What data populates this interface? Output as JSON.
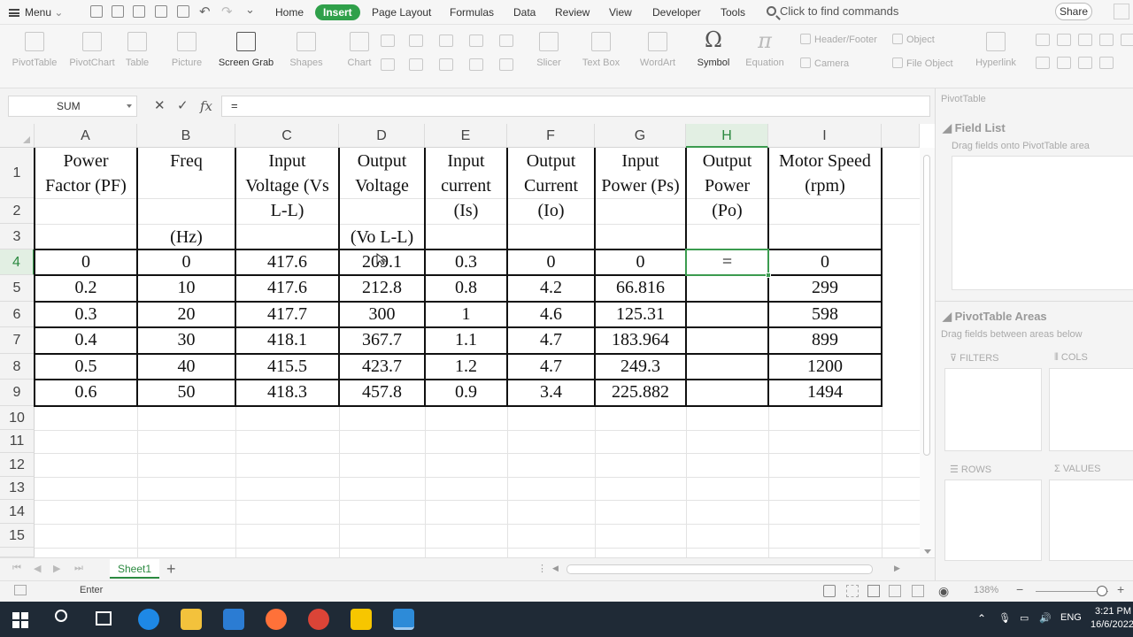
{
  "menubar": {
    "menu_label": "Menu",
    "tabs": [
      "Home",
      "Insert",
      "Page Layout",
      "Formulas",
      "Data",
      "Review",
      "View",
      "Developer",
      "Tools"
    ],
    "active_tab": "Insert",
    "find_placeholder": "Click to find commands",
    "share_label": "Share"
  },
  "ribbon": {
    "pivottable": "PivotTable",
    "pivotchart": "PivotChart",
    "table": "Table",
    "picture": "Picture",
    "screen_grab": "Screen Grab",
    "shapes": "Shapes",
    "chart": "Chart",
    "slicer": "Slicer",
    "text_box": "Text Box",
    "wordart": "WordArt",
    "symbol": "Symbol",
    "equation": "Equation",
    "header_footer": "Header/Footer",
    "object": "Object",
    "camera": "Camera",
    "file_object": "File Object",
    "hyperlink": "Hyperlink"
  },
  "formula_bar": {
    "name_box": "SUM",
    "cancel_glyph": "✕",
    "enter_glyph": "✓",
    "fx_glyph": "fx",
    "formula": "="
  },
  "sheet": {
    "columns": [
      "A",
      "B",
      "C",
      "D",
      "E",
      "F",
      "G",
      "H",
      "I"
    ],
    "selected_column": "H",
    "rows": [
      "1",
      "2",
      "3",
      "4",
      "5",
      "6",
      "7",
      "8",
      "9",
      "10",
      "11",
      "12",
      "13",
      "14",
      "15"
    ],
    "selected_row": "4",
    "headers": {
      "a": [
        "Power",
        "Factor (PF)"
      ],
      "b": [
        "Freq",
        "(Hz)"
      ],
      "c": [
        "Input",
        "Voltage (Vs",
        "L-L)"
      ],
      "d": [
        "Output",
        "Voltage",
        "(Vo L-L)"
      ],
      "e": [
        "Input",
        "current",
        "(Is)"
      ],
      "f": [
        "Output",
        "Current",
        "(Io)"
      ],
      "g": [
        "Input",
        "Power (Ps)"
      ],
      "h": [
        "Output",
        "Power",
        "(Po)"
      ],
      "i": [
        "Motor Speed",
        "(rpm)"
      ]
    },
    "data": [
      [
        "0",
        "0",
        "417.6",
        "209.1",
        "0.3",
        "0",
        "0",
        "=",
        "0"
      ],
      [
        "0.2",
        "10",
        "417.6",
        "212.8",
        "0.8",
        "4.2",
        "66.816",
        "",
        "299"
      ],
      [
        "0.3",
        "20",
        "417.7",
        "300",
        "1",
        "4.6",
        "125.31",
        "",
        "598"
      ],
      [
        "0.4",
        "30",
        "418.1",
        "367.7",
        "1.1",
        "4.7",
        "183.964",
        "",
        "899"
      ],
      [
        "0.5",
        "40",
        "415.5",
        "423.7",
        "1.2",
        "4.7",
        "249.3",
        "",
        "1200"
      ],
      [
        "0.6",
        "50",
        "418.3",
        "457.8",
        "0.9",
        "3.4",
        "225.882",
        "",
        "1494"
      ]
    ],
    "active_cell": "H4",
    "sheet_tab": "Sheet1",
    "add_sheet_glyph": "+"
  },
  "pivot_pane": {
    "title": "PivotTable",
    "field_list": "Field List",
    "field_hint": "Drag fields onto PivotTable area",
    "areas_title": "PivotTable Areas",
    "areas_hint": "Drag fields between areas below",
    "filters": "FILTERS",
    "cols": "COLS",
    "rows": "ROWS",
    "values": "VALUES"
  },
  "status": {
    "mode": "Enter",
    "zoom": "138%"
  },
  "taskbar": {
    "lang": "ENG",
    "time": "3:21 PM",
    "date": "16/6/2022"
  },
  "colors": {
    "accent_green": "#2fa04a",
    "taskbar": "#1f2a36"
  }
}
